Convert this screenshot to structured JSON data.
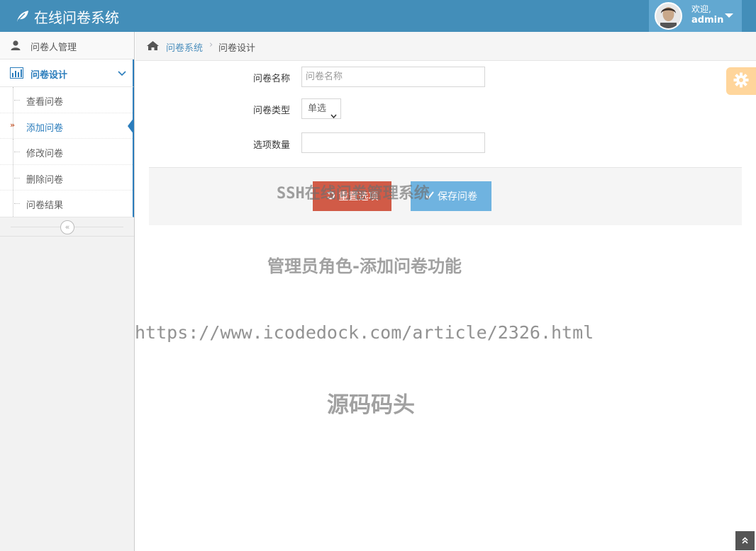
{
  "header": {
    "brand": "在线问卷系统",
    "welcome": "欢迎,",
    "username": "admin"
  },
  "sidebar": {
    "items": [
      {
        "label": "问卷人管理",
        "icon": "user-icon"
      },
      {
        "label": "问卷设计",
        "icon": "bar-chart-icon"
      }
    ],
    "submenu": [
      {
        "label": "查看问卷"
      },
      {
        "label": "添加问卷",
        "active": true
      },
      {
        "label": "修改问卷"
      },
      {
        "label": "删除问卷"
      },
      {
        "label": "问卷结果"
      }
    ],
    "collapse_glyph": "«"
  },
  "breadcrumb": {
    "root": "问卷系统",
    "current": "问卷设计"
  },
  "form": {
    "name_label": "问卷名称",
    "name_placeholder": "问卷名称",
    "type_label": "问卷类型",
    "type_value": "单选",
    "count_label": "选项数量",
    "count_value": "",
    "reset_label": "重置选项",
    "save_label": "保存问卷"
  },
  "watermarks": {
    "line1": "SSH在线问卷管理系统",
    "line2": "管理员角色-添加问卷功能",
    "line3": "https://www.icodedock.com/article/2326.html",
    "line4": "源码码头"
  },
  "colors": {
    "navbar": "#438eb9",
    "accent": "#2b7dbc",
    "reset_button": "#d15b47",
    "save_button": "#6fb3e0",
    "settings": "#ffb44b"
  }
}
